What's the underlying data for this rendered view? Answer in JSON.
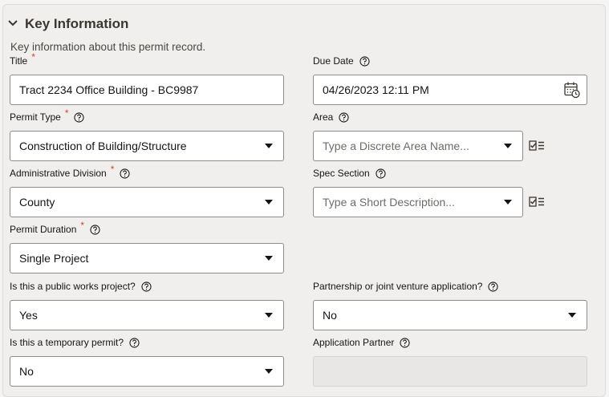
{
  "section": {
    "title": "Key Information",
    "description": "Key information about this permit record."
  },
  "fields": {
    "title": {
      "label": "Title",
      "value": "Tract 2234 Office Building - BC9987",
      "required": true
    },
    "due_date": {
      "label": "Due Date",
      "value": "04/26/2023 12:11 PM"
    },
    "permit_type": {
      "label": "Permit Type",
      "value": "Construction of Building/Structure",
      "required": true
    },
    "area": {
      "label": "Area",
      "placeholder": "Type a Discrete Area Name..."
    },
    "admin_division": {
      "label": "Administrative Division",
      "value": "County",
      "required": true
    },
    "spec_section": {
      "label": "Spec Section",
      "placeholder": "Type a Short Description..."
    },
    "permit_duration": {
      "label": "Permit Duration",
      "value": "Single Project",
      "required": true
    },
    "public_works": {
      "label": "Is this a public works project?",
      "value": "Yes"
    },
    "partnership": {
      "label": "Partnership or joint venture application?",
      "value": "No"
    },
    "temporary": {
      "label": "Is this a temporary permit?",
      "value": "No"
    },
    "app_partner": {
      "label": "Application Partner",
      "value": ""
    }
  },
  "required_marker": "*",
  "colors": {
    "required": "#c74634",
    "panel_bg": "#f1efed",
    "input_border": "#8f8b86"
  },
  "icons": [
    "chevron-down-icon",
    "help-icon",
    "calendar-icon",
    "dropdown-caret-icon",
    "list-select-icon"
  ]
}
